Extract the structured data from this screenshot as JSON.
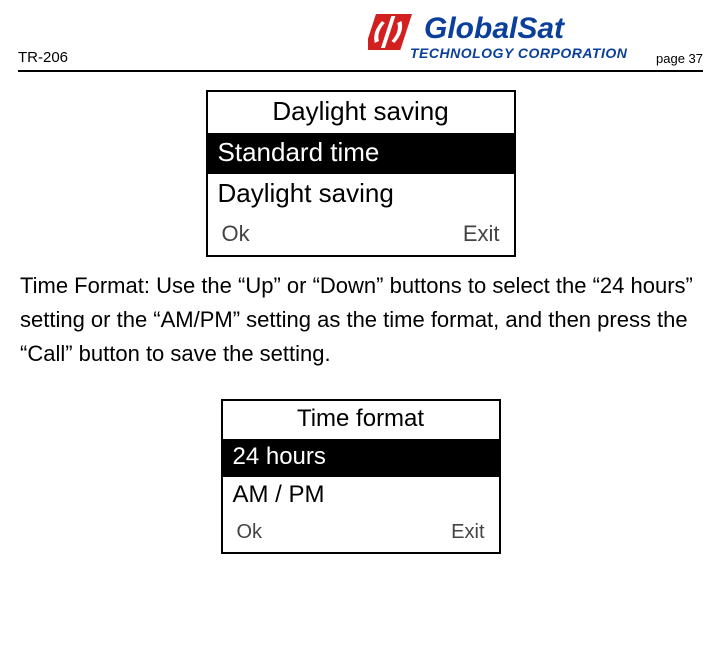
{
  "header": {
    "model": "TR-206",
    "page_number_label": "page 37",
    "logo": {
      "brand_line1": "GlobalSat",
      "brand_line2": "TECHNOLOGY CORPORATION",
      "colors": {
        "top": "#0a3f9a",
        "bottom": "#0a3f9a",
        "mark_red": "#d21f1f"
      }
    }
  },
  "screen1": {
    "title": "Daylight saving",
    "items": [
      "Standard time",
      "Daylight saving"
    ],
    "selected_index": 0,
    "softkeys": {
      "left": "Ok",
      "right": "Exit"
    }
  },
  "paragraph": "Time Format: Use the “Up” or “Down” buttons to select the “24 hours” setting or the “AM/PM” setting as the time format, and then press the “Call” button to save the setting.",
  "screen2": {
    "title": "Time format",
    "items": [
      "24 hours",
      "AM / PM"
    ],
    "selected_index": 0,
    "softkeys": {
      "left": "Ok",
      "right": "Exit"
    }
  }
}
